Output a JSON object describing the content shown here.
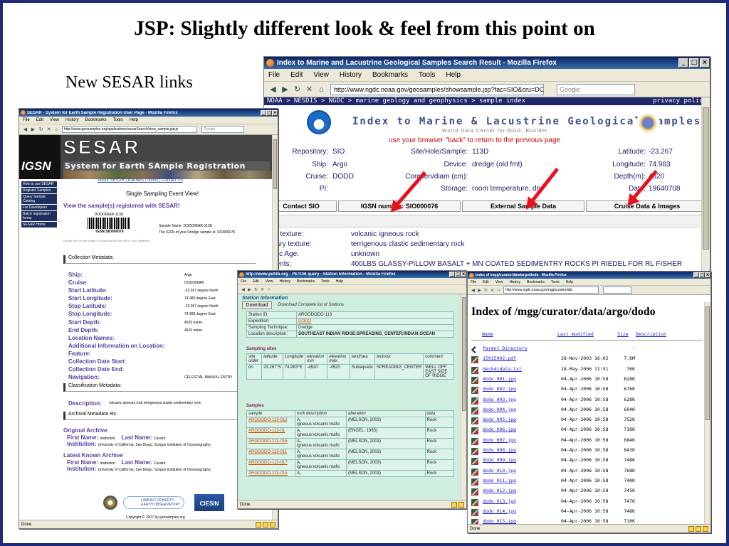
{
  "slide": {
    "title": "JSP: Slightly different look & feel from this point on",
    "note": "New SESAR links"
  },
  "noaa_window": {
    "title": "Index to Marine and Lacustrine Geological Samples Search Result - Mozilla Firefox",
    "menu": [
      "File",
      "Edit",
      "View",
      "History",
      "Bookmarks",
      "Tools",
      "Help"
    ],
    "url": "http://www.ngdc.noaa.gov/geosamples/showsample.jsp?fac=SIO&cru=DODC",
    "search_placeholder": "Google",
    "breadcrumb": "NOAA > NESDIS > NGDC > marine geology and geophysics > sample index",
    "privacy": "privacy policy",
    "heading": "Index to Marine & Lacustrine Geological Samples",
    "subheading": "World Data Center for MGG, Boulder",
    "back_note": "use your browser \"back\" to return to the previous page",
    "fields": {
      "repository_label": "Repository:",
      "repository": "SIO",
      "ship_label": "Ship:",
      "ship": "Argo",
      "cruise_label": "Cruise:",
      "cruise": "DODO",
      "pi_label": "PI:",
      "site_label": "Site/Hole/Sample:",
      "site": "113D",
      "device_label": "Device:",
      "device": "dredge (old fmt)",
      "core_label": "Core len/diam (cm):",
      "storage_label": "Storage:",
      "storage": "room temperature, dry",
      "lat_label": "Latitude:",
      "lat": "-23.267",
      "lon_label": "Longitude:",
      "lon": "74.983",
      "depth_label": "Depth(m):",
      "depth": "4520",
      "date_label": "Date:",
      "date": "19640708"
    },
    "buttons": [
      "Contact SIO",
      "IGSN number: SIO000076",
      "External Sample Data",
      "Cruise Data & Images"
    ],
    "desc": [
      {
        "label": "nary texture:",
        "value": "volcanic igneous rock"
      },
      {
        "label": "ondary texture:",
        "value": "terrigenous clastic sedimentary rock"
      },
      {
        "label": "ologic Age:",
        "value": "unknown"
      },
      {
        "label": "mments:",
        "value": "400LBS GLASSY-PILLOW BASALT + MN COATED SEDIMENTRY ROCKS PI RIEDEL FOR RL FISHER"
      }
    ]
  },
  "sesar_window": {
    "title": "SESAR - System for Earth Sample Registration User Page - Mozilla Firefox",
    "menu": [
      "File",
      "Edit",
      "View",
      "History",
      "Bookmarks",
      "Tools",
      "Help"
    ],
    "url": "http://www.geosamples.org/applications/sesarSearch/view_sample.jsp;js",
    "search_placeholder": "Google",
    "banner_logo": "IGSN",
    "banner_title": "SESAR",
    "banner_sub": "System for Earth SAmple Registration",
    "side_menu": [
      "How to use SESAR",
      "Register Samples",
      "Query Sample Catalog",
      "For Developers",
      "Batch registration forms",
      "SESAR Home"
    ],
    "top_links": "About SESAR | Partners | News | Contact Us",
    "event_title": "Single Sampling Event View!",
    "registered": "View the sample(s) registered with SESAR!",
    "barcode_top": "DODO06AR-113D",
    "barcode_igsn": "IGSN:SIO000076",
    "sample_name": "Sample Name: DODO06AR-113D",
    "igsn_line": "The IGSN of your Dredge sample is: SIO000076",
    "click_note": "Please click on the image to download the barcode in your database.",
    "sec_collection": "Collection Metadata:",
    "collection": [
      {
        "label": "Ship:",
        "value": "Argo"
      },
      {
        "label": "Cruise:",
        "value": "DODO06AR"
      },
      {
        "label": "Start Latitude:",
        "value": "-23.267 degree North"
      },
      {
        "label": "Start Longitude:",
        "value": "74.983 degree East"
      },
      {
        "label": "Stop Latitude:",
        "value": "-23.267 degree North"
      },
      {
        "label": "Stop Longitude:",
        "value": "74.983 degree East"
      },
      {
        "label": "Start Depth:",
        "value": "4520 meter"
      },
      {
        "label": "End Depth:",
        "value": "4520 meter"
      },
      {
        "label": "Location Names:",
        "value": ""
      },
      {
        "label": "Additional Information on Location:",
        "value": ""
      },
      {
        "label": "Feature:",
        "value": ""
      },
      {
        "label": "Collection Date Start:",
        "value": ""
      },
      {
        "label": "Collection Date End:",
        "value": ""
      },
      {
        "label": "Navigation:",
        "value": "CELESTIAL-MANUAL ENTRY"
      }
    ],
    "sec_classification": "Classification Metadata:",
    "description_label": "Description:",
    "description": "volcanic igneous rock terrigenous clastic sedimentary rock",
    "sec_archival": "Archival Metadata etc.",
    "original_archive": "Original Archive",
    "first_name_label": "First Name:",
    "first_name": "Institution",
    "last_name_label": "Last Name:",
    "last_name": "Curator",
    "institution_label": "Institution:",
    "institution": "University of California, San Diego, Scripps Institution of Oceanography",
    "latest_archive": "Latest Known Archive",
    "logo_ldeo": "LAMONT-DOHERTY EARTH OBSERVATORY",
    "logo_ciesin": "CIESIN",
    "copyright": "Copyright © 2007 by geosamples.org",
    "status": "Done"
  },
  "petdb_window": {
    "title": "http://www.petdb.org - PETDB query - Station Information - Mozilla Firefox",
    "menu": [
      "File",
      "Edit",
      "View",
      "History",
      "Bookmarks",
      "Tools",
      "Help"
    ],
    "section_title": "Station Information",
    "download_btn": "Download",
    "download_note": "Download Complete list of Stations",
    "station": [
      {
        "k": "Station ID:",
        "v": "ARGODODO-113"
      },
      {
        "k": "Expedition:",
        "v": "DODO"
      },
      {
        "k": "Sampling Technique:",
        "v": "Dredge"
      },
      {
        "k": "Location description:",
        "v": "SOUTHEAST INDIAN RIDGE:SPREADING_CENTER:INDIAN:OCEAN"
      }
    ],
    "sites_label": "Sampling sites",
    "site_headers": [
      "site order",
      "latitude",
      "Longitude",
      "elevation min",
      "elevation max",
      "land/sea",
      "tectonic",
      "comment"
    ],
    "site_row": [
      "on",
      "23.267°S",
      "74.983°E",
      "-4520",
      "-4520",
      "Subaquatic",
      "SPREADING_CENTER",
      "WELL OFF EAST SIDE OF RIDGE"
    ],
    "samples_label": "Samples",
    "sample_headers": [
      "sample",
      "rock description",
      "alteration",
      "data"
    ],
    "samples": [
      {
        "id": "ARGDODO-113-012",
        "desc": "A, igneous:volcanic:mafic",
        "alt": "(MELSON, 2003)",
        "data": "Rock"
      },
      {
        "id": "ARGDODO-113-01",
        "desc": "A, igneous:volcanic:mafic",
        "alt": "(ENGEL, 1965)",
        "data": "Rock"
      },
      {
        "id": "ARGDODO-113-016",
        "desc": "A, igneous:volcanic:mafic",
        "alt": "(MELSON, 2003)",
        "data": "Rock"
      },
      {
        "id": "ARGDODO-113-011",
        "desc": "A, igneous:volcanic:mafic",
        "alt": "(MELSON, 2003)",
        "data": "Rock"
      },
      {
        "id": "ARGDODO-113-017",
        "desc": "A, igneous:volcanic:mafic",
        "alt": "(MELSON, 2003)",
        "data": "Rock"
      },
      {
        "id": "ARGDODO-113-015",
        "desc": "A,",
        "alt": "(MELSON, 2003)",
        "data": "Rock"
      }
    ],
    "status": "Done"
  },
  "dir_window": {
    "title": "Index of /mgg/curator/data/argo/dodo - Mozilla Firefox",
    "menu": [
      "File",
      "Edit",
      "View",
      "History",
      "Bookmarks",
      "Tools",
      "Help"
    ],
    "url": "http://www.ngdc.noaa.gov/mgg/curator/dat",
    "heading": "Index of /mgg/curator/data/argo/dodo",
    "headers": [
      "Name",
      "Last modified",
      "Size",
      "Description"
    ],
    "files": [
      {
        "name": "Parent Directory",
        "date": "",
        "size": "-",
        "parent": true
      },
      {
        "name": "15015002.pdf",
        "date": "28-Nov-2003 16:02",
        "size": "7.6M"
      },
      {
        "name": "deck4idata.txt",
        "date": "18-May-2006 11:51",
        "size": "76K"
      },
      {
        "name": "dodo_001.jpg",
        "date": "04-Apr-2006 10:58",
        "size": "628K"
      },
      {
        "name": "dodo_002.jpg",
        "date": "04-Apr-2006 10:58",
        "size": "676K"
      },
      {
        "name": "dodo_003.jpg",
        "date": "04-Apr-2006 10:58",
        "size": "628K"
      },
      {
        "name": "dodo_004.jpg",
        "date": "04-Apr-2006 10:58",
        "size": "694K"
      },
      {
        "name": "dodo_005.jpg",
        "date": "04-Apr-2006 10:58",
        "size": "752K"
      },
      {
        "name": "dodo_006.jpg",
        "date": "04-Apr-2006 10:58",
        "size": "710K"
      },
      {
        "name": "dodo_007.jpg",
        "date": "04-Apr-2006 10:58",
        "size": "684K"
      },
      {
        "name": "dodo_008.jpg",
        "date": "04-Apr-2006 10:58",
        "size": "843K"
      },
      {
        "name": "dodo_009.jpg",
        "date": "04-Apr-2006 10:58",
        "size": "748K"
      },
      {
        "name": "dodo_010.jpg",
        "date": "04-Apr-2006 10:58",
        "size": "768K"
      },
      {
        "name": "dodo_011.jpg",
        "date": "04-Apr-2006 10:58",
        "size": "740K"
      },
      {
        "name": "dodo_012.jpg",
        "date": "04-Apr-2006 10:58",
        "size": "745K"
      },
      {
        "name": "dodo_013.jpg",
        "date": "04-Apr-2006 10:58",
        "size": "747K"
      },
      {
        "name": "dodo_014.jpg",
        "date": "04-Apr-2006 10:58",
        "size": "748K"
      },
      {
        "name": "dodo_015.jpg",
        "date": "04-Apr-2006 10:58",
        "size": "710K"
      }
    ],
    "status": "Done"
  },
  "colors": {
    "title_bar": "#0a246a",
    "frame": "#1c2a7a",
    "arrow": "#e8101a",
    "link": "#1a1acc",
    "sesar_purple": "#5a3b9d",
    "petdb_bg": "#cfeede"
  }
}
